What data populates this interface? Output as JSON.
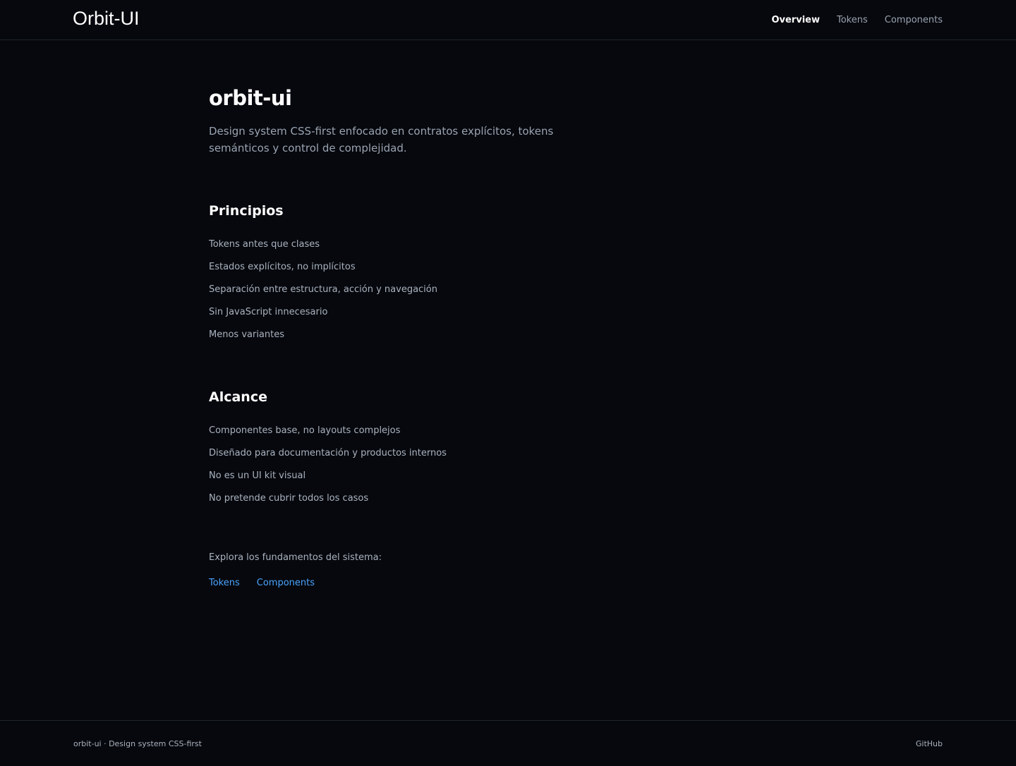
{
  "header": {
    "brand": "Orbit-UI",
    "nav": [
      {
        "label": "Overview",
        "active": true
      },
      {
        "label": "Tokens",
        "active": false
      },
      {
        "label": "Components",
        "active": false
      }
    ]
  },
  "main": {
    "title": "orbit-ui",
    "lead": "Design system CSS-first enfocado en contratos explícitos, tokens semánticos y control de complejidad.",
    "principles": {
      "title": "Principios",
      "items": [
        "Tokens antes que clases",
        "Estados explícitos, no implícitos",
        "Separación entre estructura, acción y navegación",
        "Sin JavaScript innecesario",
        "Menos variantes"
      ]
    },
    "scope": {
      "title": "Alcance",
      "items": [
        "Componentes base, no layouts complejos",
        "Diseñado para documentación y productos internos",
        "No es un UI kit visual",
        "No pretende cubrir todos los casos"
      ]
    },
    "explore": {
      "text": "Explora los fundamentos del sistema:",
      "links": [
        "Tokens",
        "Components"
      ]
    }
  },
  "footer": {
    "text": "orbit-ui · Design system CSS-first",
    "link": "GitHub"
  },
  "colors": {
    "background": "#06080d",
    "text_primary": "#ffffff",
    "text_muted": "#9aa4b2",
    "link": "#4aa3ff",
    "border": "#1f242c"
  }
}
